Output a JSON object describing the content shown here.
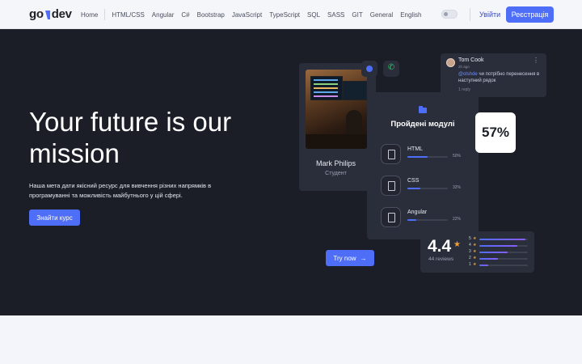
{
  "header": {
    "logo_left": "go",
    "logo_right": "dev",
    "nav": [
      "Home",
      "HTML/CSS",
      "Angular",
      "C#",
      "Bootstrap",
      "JavaScript",
      "TypeScript",
      "SQL",
      "SASS",
      "GIT",
      "General",
      "English"
    ],
    "login": "Увійти",
    "register": "Реєстрація",
    "theme_toggle": "off"
  },
  "hero": {
    "title": "Your future is our mission",
    "description": "Наша мета дати якісний ресурс для вивчення різних напрямків в програмуванні та можливість майбутнього у цій сфері.",
    "cta": "Знайти курс"
  },
  "profile": {
    "name": "Mark Philips",
    "role": "Студент",
    "icons": [
      "video-icon",
      "phone-icon"
    ]
  },
  "comment": {
    "author": "Tom Cook",
    "time": "2h ago",
    "mention": "@olshde",
    "text": " чи потрібно перенесення в наступний рядок",
    "reply": "1 reply"
  },
  "modules": {
    "title": "Пройдені модулі",
    "items": [
      {
        "name": "HTML",
        "percent": 50,
        "label": "50%"
      },
      {
        "name": "CSS",
        "percent": 32,
        "label": "32%"
      },
      {
        "name": "Angular",
        "percent": 22,
        "label": "22%"
      }
    ]
  },
  "progress_badge": "57%",
  "rating": {
    "value": "4.4",
    "reviews": "44 reviews",
    "rows": [
      {
        "stars": "5",
        "fill": 0.95
      },
      {
        "stars": "4",
        "fill": 0.78
      },
      {
        "stars": "3",
        "fill": 0.58
      },
      {
        "stars": "2",
        "fill": 0.38
      },
      {
        "stars": "1",
        "fill": 0.18
      }
    ]
  },
  "try_button": "Try now",
  "colors": {
    "accent": "#4f6ef7",
    "hero_bg": "#1b1e27",
    "card_bg": "#2a2e3a",
    "star": "#f0a23a"
  }
}
